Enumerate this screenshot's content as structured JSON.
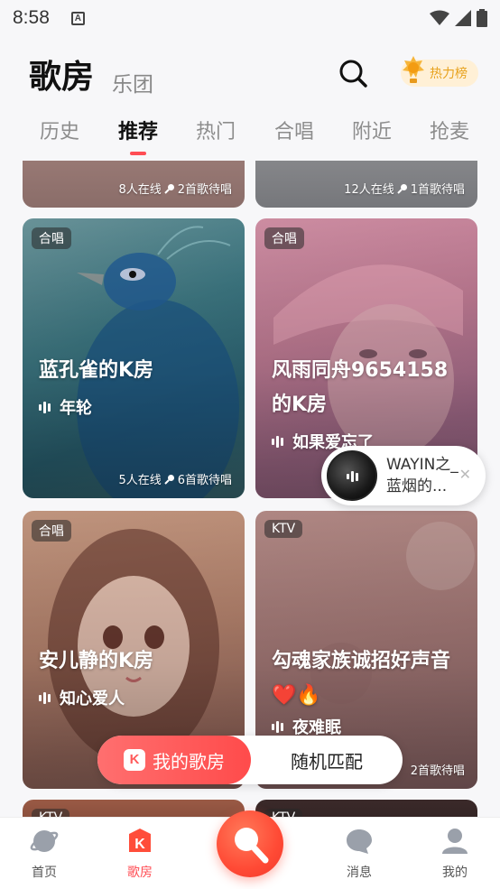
{
  "status": {
    "time": "8:58"
  },
  "header": {
    "title": "歌房",
    "subtitle": "乐团",
    "hot_label": "热力榜"
  },
  "tabs": [
    {
      "label": "历史"
    },
    {
      "label": "推荐"
    },
    {
      "label": "热门"
    },
    {
      "label": "合唱"
    },
    {
      "label": "附近"
    },
    {
      "label": "抢麦"
    }
  ],
  "active_tab": "推荐",
  "top_cards": [
    {
      "online": "8人在线",
      "waiting": "2首歌待唱"
    },
    {
      "online": "12人在线",
      "waiting": "1首歌待唱"
    }
  ],
  "cards": [
    {
      "tag": "合唱",
      "title": "蓝孔雀的K房",
      "song": "年轮",
      "online": "5人在线",
      "waiting": "6首歌待唱"
    },
    {
      "tag": "合唱",
      "title": "风雨同舟9654158的K房",
      "song": "如果爱忘了",
      "online": "",
      "waiting": ""
    },
    {
      "tag": "合唱",
      "title": "安儿静的K房",
      "song": "知心爱人",
      "online": "",
      "waiting": ""
    },
    {
      "tag": "KTV",
      "title": "勾魂家族诚招好声音❤️🔥",
      "song": "夜难眠",
      "online": "",
      "waiting": "2首歌待唱"
    }
  ],
  "bottom_cards": [
    {
      "tag": "KTV"
    },
    {
      "tag": "KTV"
    }
  ],
  "float_player": {
    "text": "WAYIN之_蓝烟的..."
  },
  "actions": {
    "my_room": "我的歌房",
    "random": "随机匹配"
  },
  "nav": [
    {
      "label": "首页"
    },
    {
      "label": "歌房"
    },
    {
      "label": "消息"
    },
    {
      "label": "我的"
    }
  ]
}
